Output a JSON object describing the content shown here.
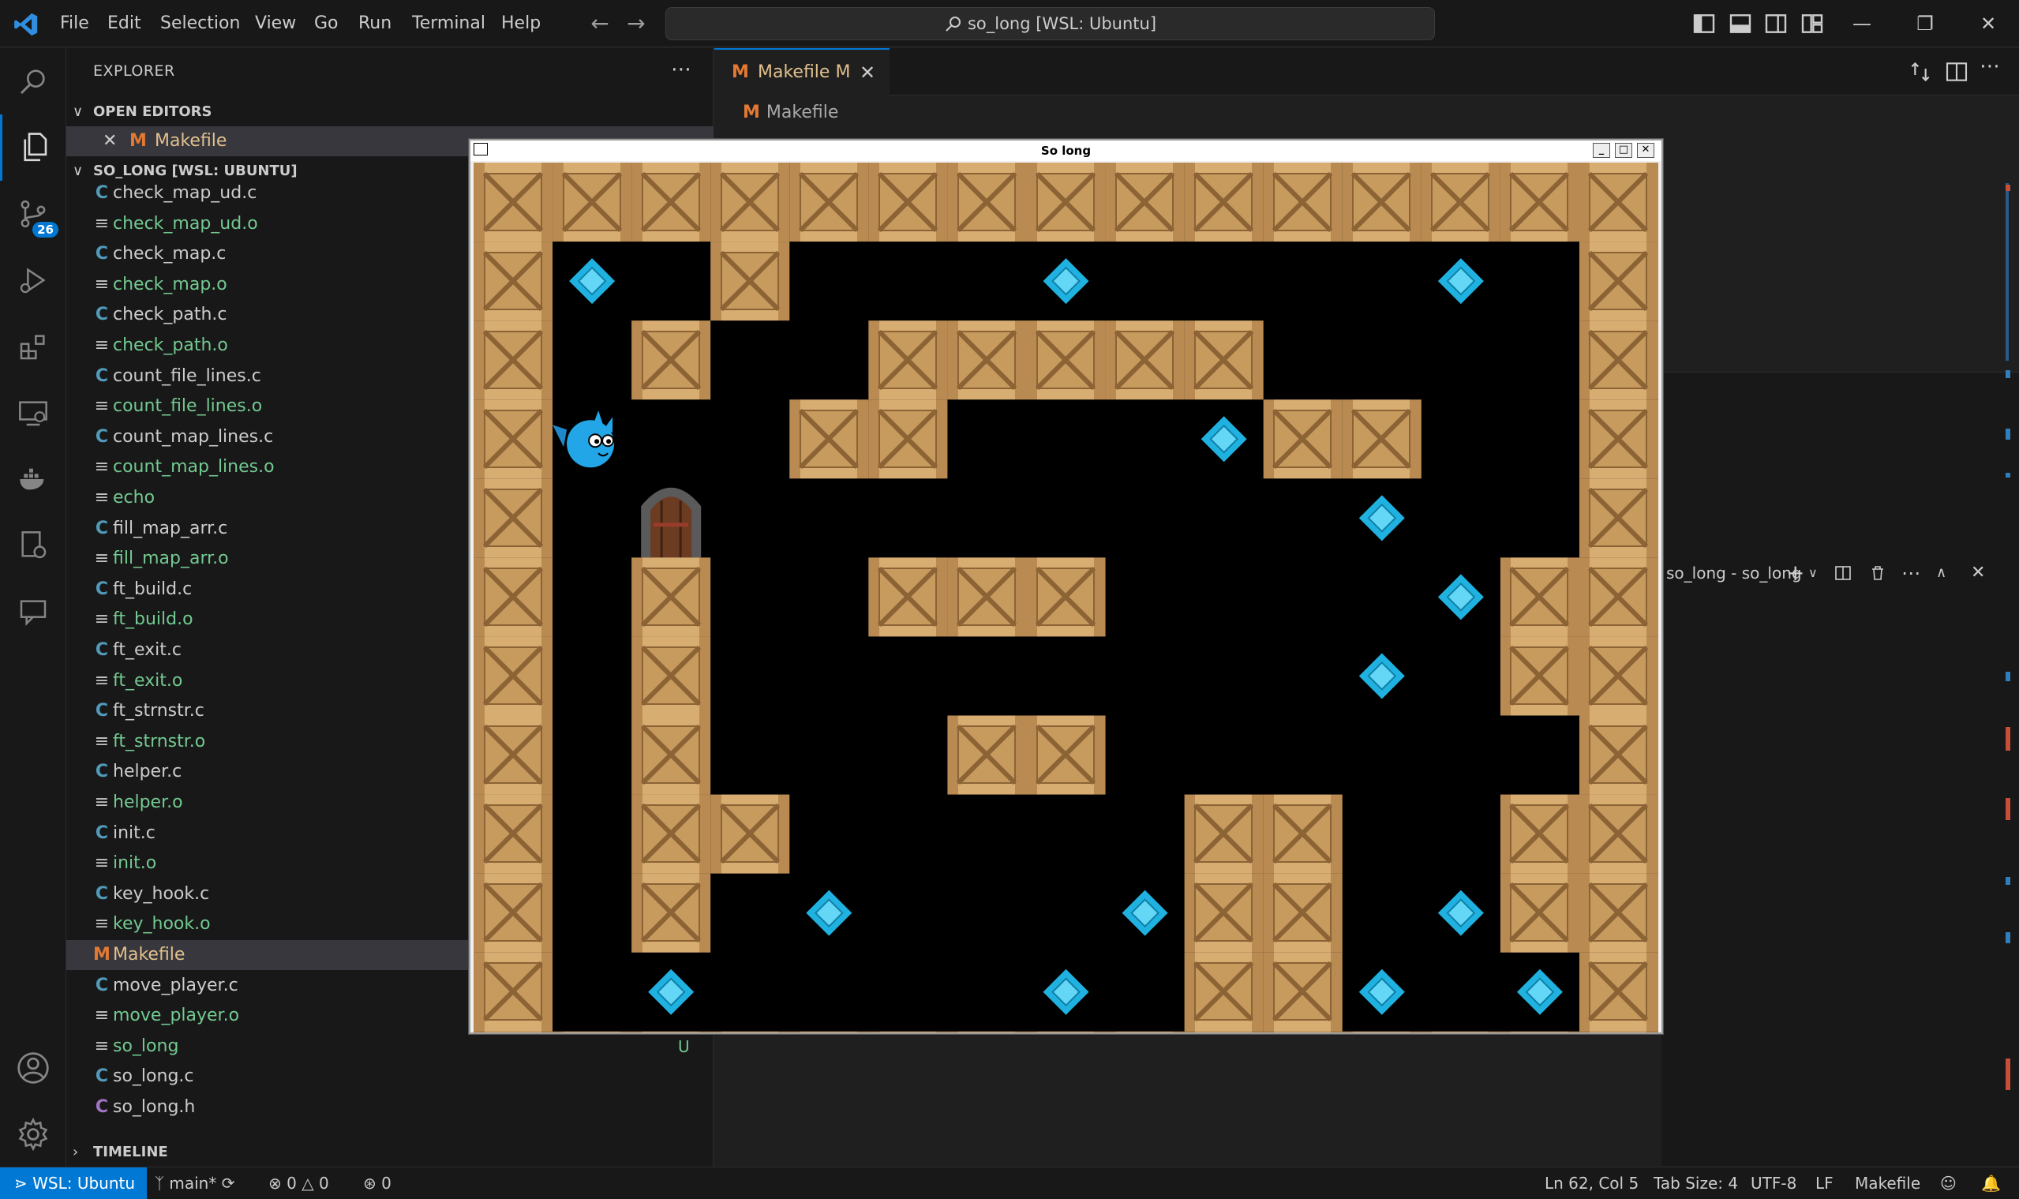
{
  "titlebar": {
    "menu": [
      "File",
      "Edit",
      "Selection",
      "View",
      "Go",
      "Run",
      "Terminal",
      "Help"
    ],
    "command_center": "so_long [WSL: Ubuntu]"
  },
  "activity": {
    "scm_badge": "26"
  },
  "sidebar": {
    "title": "EXPLORER",
    "open_editors_label": "OPEN EDITORS",
    "open_editor_file": "Makefile",
    "folder_label": "SO_LONG [WSL: UBUNTU]",
    "timeline_label": "TIMELINE",
    "files": [
      {
        "name": "check_map_ud.c",
        "type": "c",
        "color": "white"
      },
      {
        "name": "check_map_ud.o",
        "type": "o",
        "color": "green"
      },
      {
        "name": "check_map.c",
        "type": "c",
        "color": "white"
      },
      {
        "name": "check_map.o",
        "type": "o",
        "color": "green"
      },
      {
        "name": "check_path.c",
        "type": "c",
        "color": "white"
      },
      {
        "name": "check_path.o",
        "type": "o",
        "color": "green"
      },
      {
        "name": "count_file_lines.c",
        "type": "c",
        "color": "white"
      },
      {
        "name": "count_file_lines.o",
        "type": "o",
        "color": "green"
      },
      {
        "name": "count_map_lines.c",
        "type": "c",
        "color": "white"
      },
      {
        "name": "count_map_lines.o",
        "type": "o",
        "color": "green"
      },
      {
        "name": "echo",
        "type": "o",
        "color": "green"
      },
      {
        "name": "fill_map_arr.c",
        "type": "c",
        "color": "white"
      },
      {
        "name": "fill_map_arr.o",
        "type": "o",
        "color": "green"
      },
      {
        "name": "ft_build.c",
        "type": "c",
        "color": "white"
      },
      {
        "name": "ft_build.o",
        "type": "o",
        "color": "green"
      },
      {
        "name": "ft_exit.c",
        "type": "c",
        "color": "white"
      },
      {
        "name": "ft_exit.o",
        "type": "o",
        "color": "green"
      },
      {
        "name": "ft_strnstr.c",
        "type": "c",
        "color": "white"
      },
      {
        "name": "ft_strnstr.o",
        "type": "o",
        "color": "green"
      },
      {
        "name": "helper.c",
        "type": "c",
        "color": "white"
      },
      {
        "name": "helper.o",
        "type": "o",
        "color": "green"
      },
      {
        "name": "init.c",
        "type": "c",
        "color": "white"
      },
      {
        "name": "init.o",
        "type": "o",
        "color": "green"
      },
      {
        "name": "key_hook.c",
        "type": "c",
        "color": "white"
      },
      {
        "name": "key_hook.o",
        "type": "o",
        "color": "green"
      },
      {
        "name": "Makefile",
        "type": "m",
        "color": "mod"
      },
      {
        "name": "move_player.c",
        "type": "c",
        "color": "white"
      },
      {
        "name": "move_player.o",
        "type": "o",
        "color": "green"
      },
      {
        "name": "so_long",
        "type": "o",
        "color": "green",
        "badge": "U"
      },
      {
        "name": "so_long.c",
        "type": "c",
        "color": "white"
      },
      {
        "name": "so_long.h",
        "type": "h",
        "color": "white"
      }
    ]
  },
  "editor": {
    "tab_label": "Makefile",
    "tab_status": "M",
    "breadcrumb": "Makefile",
    "terminal_title": "so_long - so_long"
  },
  "game": {
    "window_title": "So long",
    "map": [
      "111111111111111",
      "1C01000C0000C01",
      "101001111100001",
      "1P0011000C11001",
      "10E00000000C001",
      "101001110000C11",
      "10100000000C011",
      "101000110000001",
      "101100000110011",
      "1010C000C110C11",
      "10C0000C011C0C11",
      "111111111111111"
    ]
  },
  "status": {
    "remote": "WSL: Ubuntu",
    "branch": "main*",
    "errors": "0",
    "warnings": "0",
    "ports": "0",
    "position": "Ln 62, Col 5",
    "tab_size": "Tab Size: 4",
    "encoding": "UTF-8",
    "eol": "LF",
    "language": "Makefile"
  },
  "colors": {
    "accent": "#0078d4",
    "git_modified": "#e2c08d",
    "git_untracked": "#73c991"
  }
}
